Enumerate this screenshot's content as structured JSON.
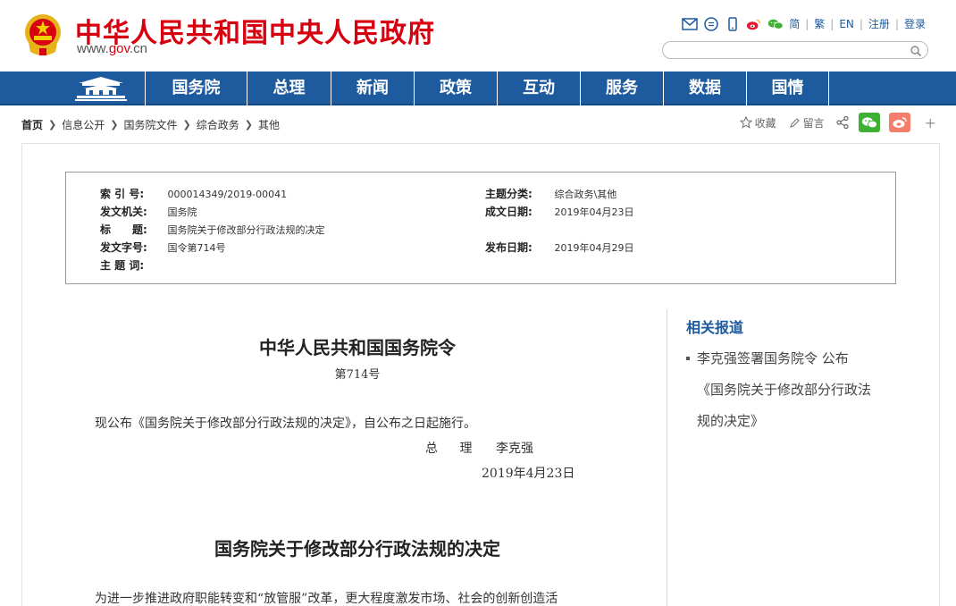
{
  "header": {
    "site_title": "中华人民共和国中央人民政府",
    "url_www": "www.",
    "url_gov": "gov",
    "url_cn": ".cn",
    "links": [
      "简",
      "繁",
      "EN",
      "注册",
      "登录"
    ],
    "search_placeholder": ""
  },
  "nav": {
    "items": [
      "国务院",
      "总理",
      "新闻",
      "政策",
      "互动",
      "服务",
      "数据",
      "国情"
    ]
  },
  "breadcrumb": {
    "items": [
      "首页",
      "信息公开",
      "国务院文件",
      "综合政务",
      "其他"
    ]
  },
  "tools": {
    "favorite": "收藏",
    "comment": "留言",
    "more": "+"
  },
  "meta": {
    "index_label": "索 引 号:",
    "index_value": "000014349/2019-00041",
    "issuer_label": "发文机关:",
    "issuer_value": "国务院",
    "title_label": "标　　题:",
    "title_value": "国务院关于修改部分行政法规的决定",
    "docno_label": "发文字号:",
    "docno_value": "国令第714号",
    "subject_label": "主 题 词:",
    "subject_value": "",
    "category_label": "主题分类:",
    "category_value": "综合政务\\其他",
    "created_label": "成文日期:",
    "created_value": "2019年04月23日",
    "published_label": "发布日期:",
    "published_value": "2019年04月29日"
  },
  "article": {
    "decree_title": "中华人民共和国国务院令",
    "decree_no": "第714号",
    "para1": "现公布《国务院关于修改部分行政法规的决定》，自公布之日起施行。",
    "sign_role": "总 理",
    "sign_name": "李克强",
    "sign_date": "2019年4月23日",
    "title2": "国务院关于修改部分行政法规的决定",
    "para2": "为进一步推进政府职能转变和“放管服”改革，更大程度激发市场、社会的创新创造活"
  },
  "sidebar": {
    "title": "相关报道",
    "item_line1": "李克强签署国务院令 公布",
    "item_line2": "《国务院关于修改部分行政法",
    "item_line3": "规的决定》"
  },
  "colors": {
    "brand_red": "#d7000f",
    "nav_blue": "#1d5a9e"
  }
}
